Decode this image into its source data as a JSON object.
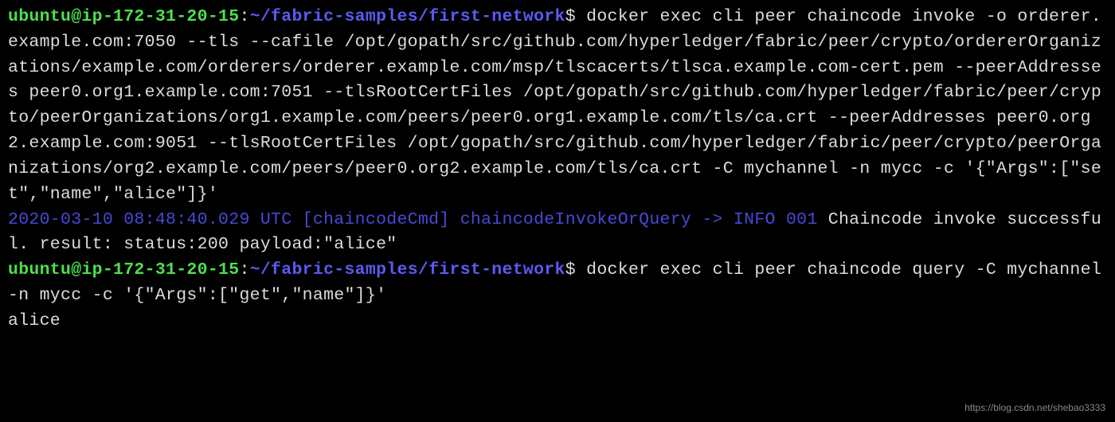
{
  "prompt1": {
    "user_host": "ubuntu@ip-172-31-20-15",
    "sep1": ":",
    "cwd": "~/fabric-samples/first-network",
    "sep2": "$",
    "command": " docker exec cli peer chaincode invoke -o orderer.example.com:7050 --tls --cafile /opt/gopath/src/github.com/hyperledger/fabric/peer/crypto/ordererOrganizations/example.com/orderers/orderer.example.com/msp/tlscacerts/tlsca.example.com-cert.pem --peerAddresses peer0.org1.example.com:7051 --tlsRootCertFiles /opt/gopath/src/github.com/hyperledger/fabric/peer/crypto/peerOrganizations/org1.example.com/peers/peer0.org1.example.com/tls/ca.crt --peerAddresses peer0.org2.example.com:9051 --tlsRootCertFiles /opt/gopath/src/github.com/hyperledger/fabric/peer/crypto/peerOrganizations/org2.example.com/peers/peer0.org2.example.com/tls/ca.crt -C mychannel -n mycc -c '{\"Args\":[\"set\",\"name\",\"alice\"]}'"
  },
  "log1": {
    "info_prefix": "2020-03-10 08:48:40.029 UTC [chaincodeCmd] chaincodeInvokeOrQuery -> INFO 001",
    "message": " Chaincode invoke successful. result: status:200 payload:\"alice\""
  },
  "prompt2": {
    "user_host": "ubuntu@ip-172-31-20-15",
    "sep1": ":",
    "cwd": "~/fabric-samples/first-network",
    "sep2": "$",
    "command": " docker exec cli peer chaincode query -C mychannel -n mycc -c '{\"Args\":[\"get\",\"name\"]}'"
  },
  "output2": "alice",
  "watermark": "https://blog.csdn.net/shebao3333"
}
